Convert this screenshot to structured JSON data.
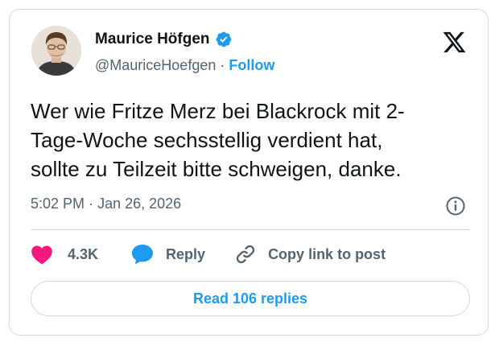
{
  "author": {
    "name": "Maurice Höfgen",
    "handle": "@MauriceHoefgen",
    "separator": "·",
    "follow_label": "Follow",
    "verified_icon": "verified-badge-icon",
    "verified_color": "#1d9bf0"
  },
  "platform_icon": "x-logo-icon",
  "tweet": {
    "lines": [
      "Wer wie Fritze Merz bei Blackrock mit 2-",
      "Tage-Woche sechsstellig verdient hat,",
      "sollte zu Teilzeit bitte schweigen, danke."
    ]
  },
  "meta": {
    "time": "5:02 PM",
    "separator": "·",
    "date": "Jan 26, 2026",
    "info_icon": "info-icon"
  },
  "actions": {
    "like_count": "4.3K",
    "like_icon": "heart-icon",
    "like_color": "#f91880",
    "reply_label": "Reply",
    "reply_icon": "speech-bubble-icon",
    "copy_label": "Copy link to post",
    "copy_icon": "link-icon"
  },
  "read_replies_label": "Read 106 replies",
  "colors": {
    "accent": "#1d9bf0",
    "text": "#0f1419",
    "muted": "#536471",
    "border": "#cfd9de"
  }
}
